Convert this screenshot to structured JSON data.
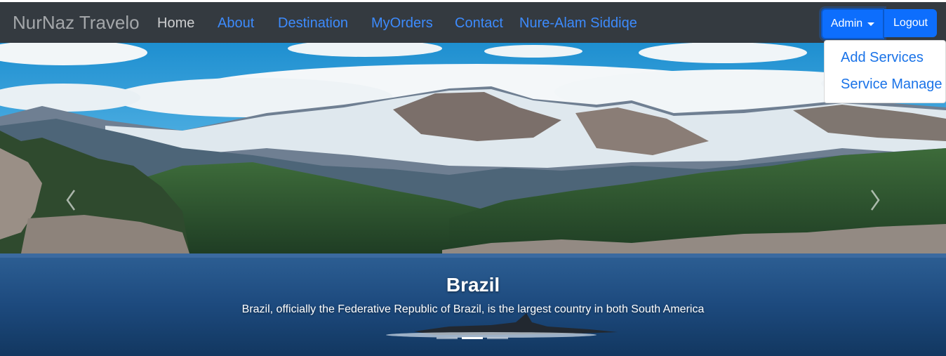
{
  "navbar": {
    "brand": "NurNaz Travelo",
    "links": [
      "Home",
      "About",
      "Destination",
      "MyOrders",
      "Contact"
    ],
    "user_name": "Nure-Alam Siddiqe",
    "admin_label": "Admin",
    "logout_label": "Logout"
  },
  "admin_menu": {
    "items": [
      "Add Services",
      "Service Manage"
    ]
  },
  "carousel": {
    "title": "Brazil",
    "description": "Brazil, officially the Federative Republic of Brazil, is the largest country in both South America",
    "active_slide": 2,
    "slide_count": 3
  },
  "colors": {
    "navbar_bg": "#343a40",
    "link_blue": "#3d8bfd",
    "button_primary": "#0d6efd"
  }
}
